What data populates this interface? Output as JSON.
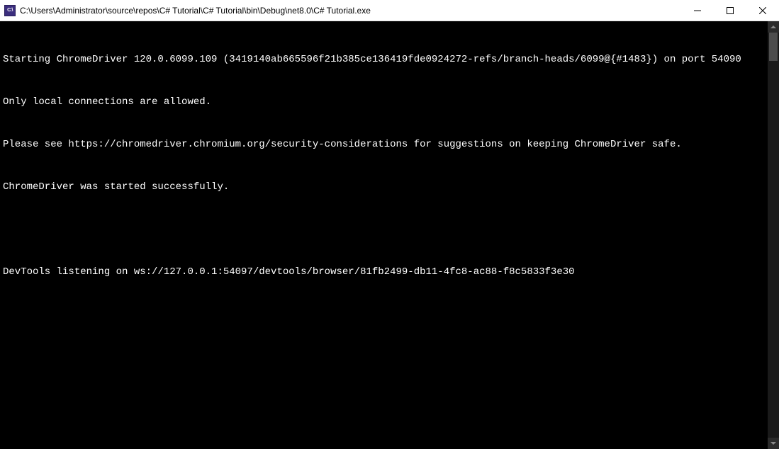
{
  "window": {
    "icon_text": "C:\\",
    "title": "C:\\Users\\Administrator\\source\\repos\\C# Tutorial\\C# Tutorial\\bin\\Debug\\net8.0\\C# Tutorial.exe"
  },
  "console": {
    "lines": [
      "Starting ChromeDriver 120.0.6099.109 (3419140ab665596f21b385ce136419fde0924272-refs/branch-heads/6099@{#1483}) on port 54090",
      "Only local connections are allowed.",
      "Please see https://chromedriver.chromium.org/security-considerations for suggestions on keeping ChromeDriver safe.",
      "ChromeDriver was started successfully.",
      "",
      "DevTools listening on ws://127.0.0.1:54097/devtools/browser/81fb2499-db11-4fc8-ac88-f8c5833f3e30"
    ]
  }
}
